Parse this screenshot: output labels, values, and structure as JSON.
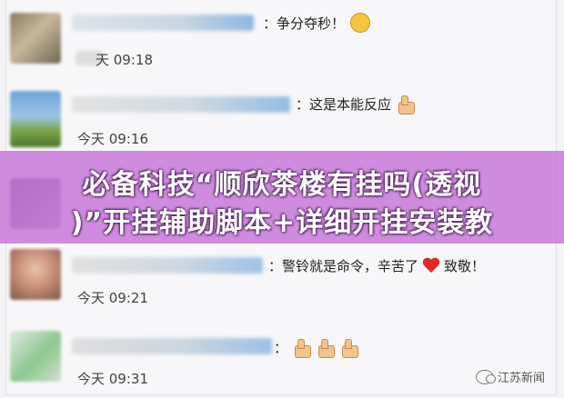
{
  "messages": [
    {
      "text": "：争分夺秒！",
      "time": "天 09:18",
      "emoji": "smiley-emoji"
    },
    {
      "text": "：这是本能反应",
      "time": "今天 09:16",
      "emoji": "thumbs-up-emoji"
    },
    {
      "text": "：警铃就是命令，辛苦了",
      "text2": "致敬！",
      "time": "今天 09:21",
      "emoji": "heart-emoji"
    },
    {
      "text": "：",
      "time": "今天 09:31",
      "emoji": "thumbs-up-emoji"
    }
  ],
  "banner": {
    "line1": "必备科技“顺欣茶楼有挂吗(透视",
    "line2": ")”开挂辅助脚本+详细开挂安装教"
  },
  "watermark": {
    "label": "江苏新闻",
    "icon": "wechat-icon"
  },
  "colors": {
    "banner": "#c46ed6",
    "heart": "#e02828"
  }
}
